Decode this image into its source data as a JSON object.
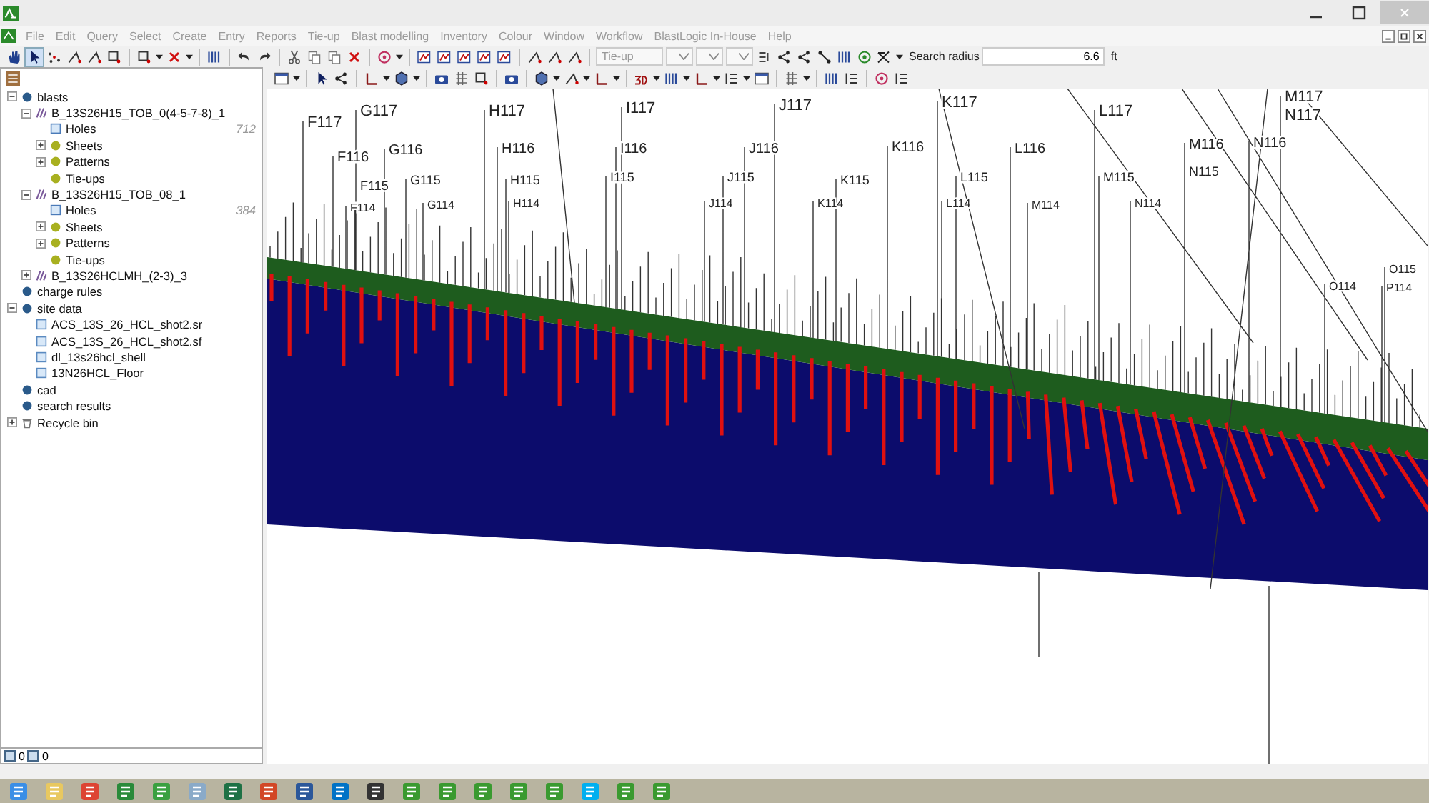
{
  "menu": [
    "File",
    "Edit",
    "Query",
    "Select",
    "Create",
    "Entry",
    "Reports",
    "Tie-up",
    "Blast modelling",
    "Inventory",
    "Colour",
    "Window",
    "Workflow",
    "BlastLogic In-House",
    "Help"
  ],
  "toolbar": {
    "mode_dropdown": {
      "value": "Tie-up"
    },
    "search_radius": {
      "label": "Search radius",
      "value": "6.6",
      "unit": "ft"
    }
  },
  "tree": [
    {
      "label": "blasts",
      "kind": "database",
      "expanded": true,
      "children": [
        {
          "label": "B_13S26H15_TOB_0(4-5-7-8)_1",
          "kind": "blast",
          "expanded": true,
          "children": [
            {
              "label": "Holes",
              "kind": "holes",
              "count": "712"
            },
            {
              "label": "Sheets",
              "kind": "group",
              "expanded": false
            },
            {
              "label": "Patterns",
              "kind": "group",
              "expanded": false
            },
            {
              "label": "Tie-ups",
              "kind": "group"
            }
          ]
        },
        {
          "label": "B_13S26H15_TOB_08_1",
          "kind": "blast",
          "expanded": true,
          "children": [
            {
              "label": "Holes",
              "kind": "holes",
              "count": "384"
            },
            {
              "label": "Sheets",
              "kind": "group",
              "expanded": false
            },
            {
              "label": "Patterns",
              "kind": "group",
              "expanded": false
            },
            {
              "label": "Tie-ups",
              "kind": "group"
            }
          ]
        },
        {
          "label": "B_13S26HCLMH_(2-3)_3",
          "kind": "blast",
          "expanded": false
        }
      ]
    },
    {
      "label": "charge rules",
      "kind": "database"
    },
    {
      "label": "site data",
      "kind": "database",
      "expanded": true,
      "children": [
        {
          "label": "ACS_13S_26_HCL_shot2.sr",
          "kind": "surface"
        },
        {
          "label": "ACS_13S_26_HCL_shot2.sf",
          "kind": "surface"
        },
        {
          "label": "dl_13s26hcl_shell",
          "kind": "surface"
        },
        {
          "label": "13N26HCL_Floor",
          "kind": "surface"
        }
      ]
    },
    {
      "label": "cad",
      "kind": "database"
    },
    {
      "label": "search results",
      "kind": "database"
    },
    {
      "label": "Recycle bin",
      "kind": "bin",
      "expanded": false
    }
  ],
  "status_bar": {
    "counts": [
      "0",
      "0"
    ]
  },
  "view": {
    "hole_labels": [
      "F117",
      "G117",
      "H117",
      "I117",
      "J117",
      "K117",
      "L117",
      "M117",
      "N117",
      "F116",
      "G116",
      "H116",
      "I116",
      "J116",
      "K116",
      "L116",
      "M116",
      "N116",
      "F115",
      "G115",
      "H115",
      "I115",
      "J115",
      "K115",
      "L115",
      "M115",
      "N115",
      "F114",
      "G114",
      "H114",
      "J114",
      "K114",
      "L114",
      "M114",
      "N114",
      "O115",
      "O114",
      "P114"
    ]
  }
}
